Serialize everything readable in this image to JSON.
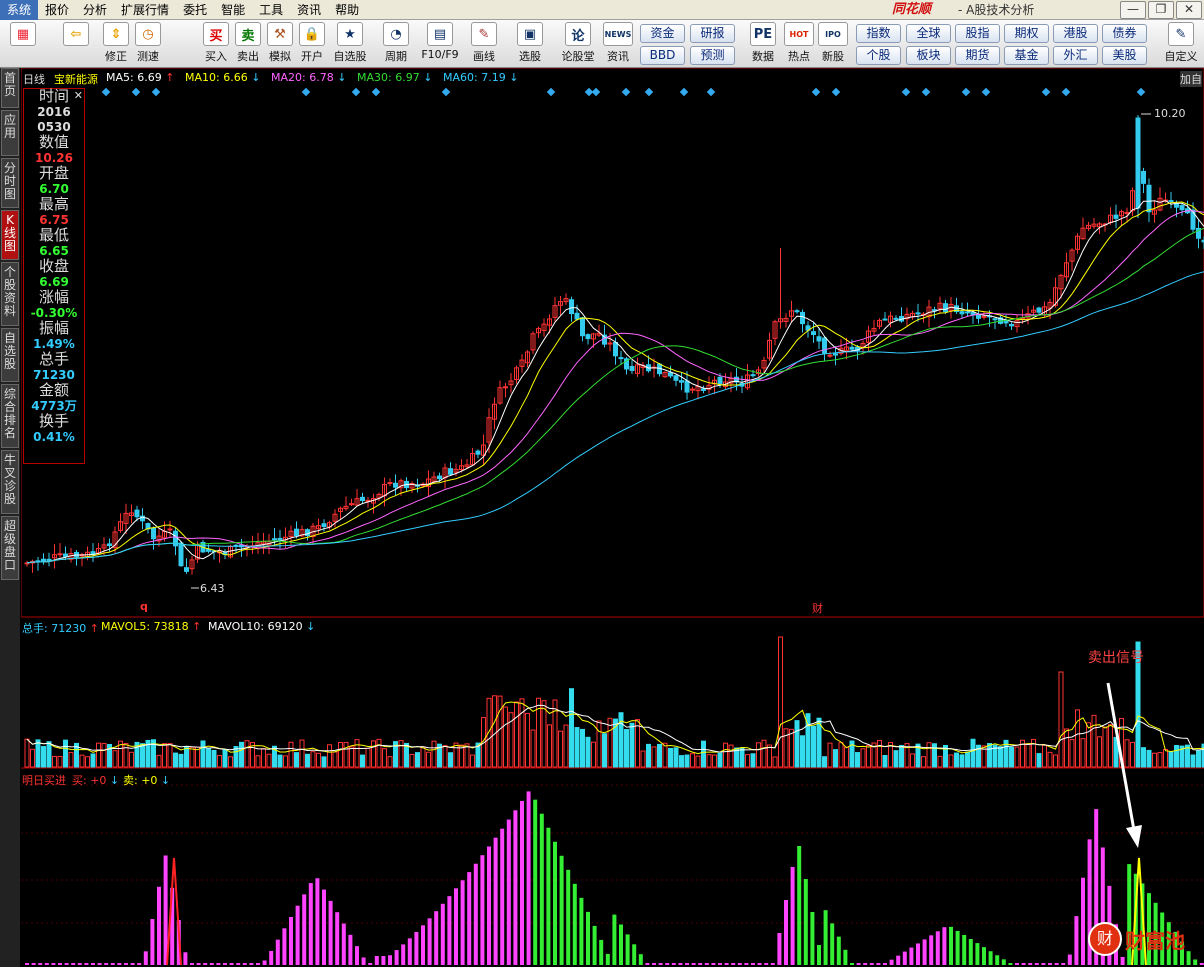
{
  "menu": [
    {
      "label": "系统",
      "active": true
    },
    {
      "label": "报价"
    },
    {
      "label": "分析"
    },
    {
      "label": "扩展行情"
    },
    {
      "label": "委托"
    },
    {
      "label": "智能"
    },
    {
      "label": "工具"
    },
    {
      "label": "资讯"
    },
    {
      "label": "帮助"
    }
  ],
  "brand": "同花顺",
  "module": "- A股技术分析",
  "window_buttons": [
    "—",
    "❐",
    "✕"
  ],
  "toolbar": [
    {
      "label": "",
      "icon": "layout-icon",
      "glyph": "▦",
      "color": "#e23"
    },
    {
      "label": "",
      "icon": "back-arrow-icon",
      "glyph": "⇦",
      "color": "#e9a200"
    },
    {
      "label": "修正",
      "icon": "updown-arrow-icon",
      "glyph": "⇕",
      "color": "#e9a200"
    },
    {
      "label": "测速",
      "icon": "clock-icon",
      "glyph": "◷",
      "color": "#c60"
    },
    {
      "label": "买入",
      "icon": "buy-icon",
      "glyph": "买",
      "color": "#d00"
    },
    {
      "label": "卖出",
      "icon": "sell-icon",
      "glyph": "卖",
      "color": "#070"
    },
    {
      "label": "模拟",
      "icon": "hammer-icon",
      "glyph": "⚒",
      "color": "#a52"
    },
    {
      "label": "开户",
      "icon": "lock-icon",
      "glyph": "🔒",
      "color": "#c90"
    },
    {
      "label": "自选股",
      "icon": "star-icon",
      "glyph": "★",
      "color": "#136"
    },
    {
      "label": "周期",
      "icon": "period-icon",
      "glyph": "◔",
      "color": "#136"
    },
    {
      "label": "F10/F9",
      "icon": "f10-icon",
      "glyph": "▤",
      "color": "#136"
    },
    {
      "label": "画线",
      "icon": "pencil-icon",
      "glyph": "✎",
      "color": "#a33"
    },
    {
      "label": "选股",
      "icon": "screen-icon",
      "glyph": "▣",
      "color": "#136"
    },
    {
      "label": "论股堂",
      "icon": "forum-icon",
      "glyph": "论",
      "color": "#136"
    },
    {
      "label": "资讯",
      "icon": "news-icon",
      "glyph": "NEWS",
      "color": "#136"
    },
    {
      "label": "数据",
      "icon": "pe-icon",
      "glyph": "PE",
      "color": "#136"
    },
    {
      "label": "热点",
      "icon": "hot-icon",
      "glyph": "HOT",
      "color": "#d20"
    },
    {
      "label": "新股",
      "icon": "ipo-icon",
      "glyph": "IPO",
      "color": "#136"
    },
    {
      "label": "自定义",
      "icon": "custom-icon",
      "glyph": "✎",
      "color": "#136"
    }
  ],
  "quick_buttons": [
    "资金",
    "研报",
    "BBD",
    "预测",
    "指数",
    "全球",
    "股指",
    "期权",
    "港股",
    "债券",
    "个股",
    "板块",
    "期货",
    "基金",
    "外汇",
    "美股"
  ],
  "sidebar": [
    "首页",
    "应用",
    "分时图",
    "K线图",
    "个股资料",
    "自选股",
    "综合排名",
    "牛叉诊股",
    "超级盘口"
  ],
  "kline_header": {
    "period": "日线",
    "stock": "宝新能源",
    "ma": [
      {
        "label": "MA5: 6.69",
        "arrow": "↑",
        "color": "#ffffff"
      },
      {
        "label": "MA10: 6.66",
        "arrow": "↓",
        "color": "#ffff00"
      },
      {
        "label": "MA20: 6.78",
        "arrow": "↓",
        "color": "#ff66ff"
      },
      {
        "label": "MA30: 6.97",
        "arrow": "↓",
        "color": "#33dd33"
      },
      {
        "label": "MA60: 7.19",
        "arrow": "↓",
        "color": "#33ccff"
      }
    ],
    "add": "加自"
  },
  "info_panel": {
    "rows": [
      {
        "label": "时间",
        "values": [
          "2016",
          "0530"
        ],
        "color": "#dddddd"
      },
      {
        "label": "数值",
        "values": [
          "10.26"
        ],
        "color": "#ff3333"
      },
      {
        "label": "开盘",
        "values": [
          "6.70"
        ],
        "color": "#33ff33"
      },
      {
        "label": "最高",
        "values": [
          "6.75"
        ],
        "color": "#ff3333"
      },
      {
        "label": "最低",
        "values": [
          "6.65"
        ],
        "color": "#33ff33"
      },
      {
        "label": "收盘",
        "values": [
          "6.69"
        ],
        "color": "#33ff33"
      },
      {
        "label": "涨幅",
        "values": [
          "-0.30%"
        ],
        "color": "#33ff33"
      },
      {
        "label": "振幅",
        "values": [
          "1.49%"
        ],
        "color": "#33ccff"
      },
      {
        "label": "总手",
        "values": [
          "71230"
        ],
        "color": "#33ccff"
      },
      {
        "label": "金额",
        "values": [
          "4773万"
        ],
        "color": "#33ccff"
      },
      {
        "label": "换手",
        "values": [
          "0.41%"
        ],
        "color": "#33ccff"
      }
    ]
  },
  "price_labels": {
    "high": "10.20",
    "low": "6.43"
  },
  "event_markers": {
    "q": "q",
    "cai": "财"
  },
  "volume_header": {
    "items": [
      {
        "label": "总手: 71230",
        "arrow": "↑",
        "color": "#33ccff"
      },
      {
        "label": "MAVOL5: 73818",
        "arrow": "↑",
        "color": "#ffff00"
      },
      {
        "label": "MAVOL10: 69120",
        "arrow": "↓",
        "color": "#ffffff"
      }
    ]
  },
  "signal_header": {
    "title": "明日买进",
    "items": [
      {
        "label": "买: +0",
        "arrow": "↓",
        "color": "#ff3333"
      },
      {
        "label": "卖: +0",
        "arrow": "↓",
        "color": "#ffff00"
      }
    ]
  },
  "annotation": "卖出信号",
  "watermark": "财富池",
  "chart_data": {
    "type": "candlestick",
    "title": "宝新能源 日线",
    "ma_latest": {
      "MA5": 6.69,
      "MA10": 6.66,
      "MA20": 6.78,
      "MA30": 6.97,
      "MA60": 7.19
    },
    "y_marks": {
      "high": 10.2,
      "low": 6.43
    },
    "volume_latest": {
      "vol": 71230,
      "MAVOL5": 73818,
      "MAVOL10": 69120
    },
    "indicator": "明日买进",
    "indicator_values": {
      "buy": 0,
      "sell": 0
    }
  }
}
